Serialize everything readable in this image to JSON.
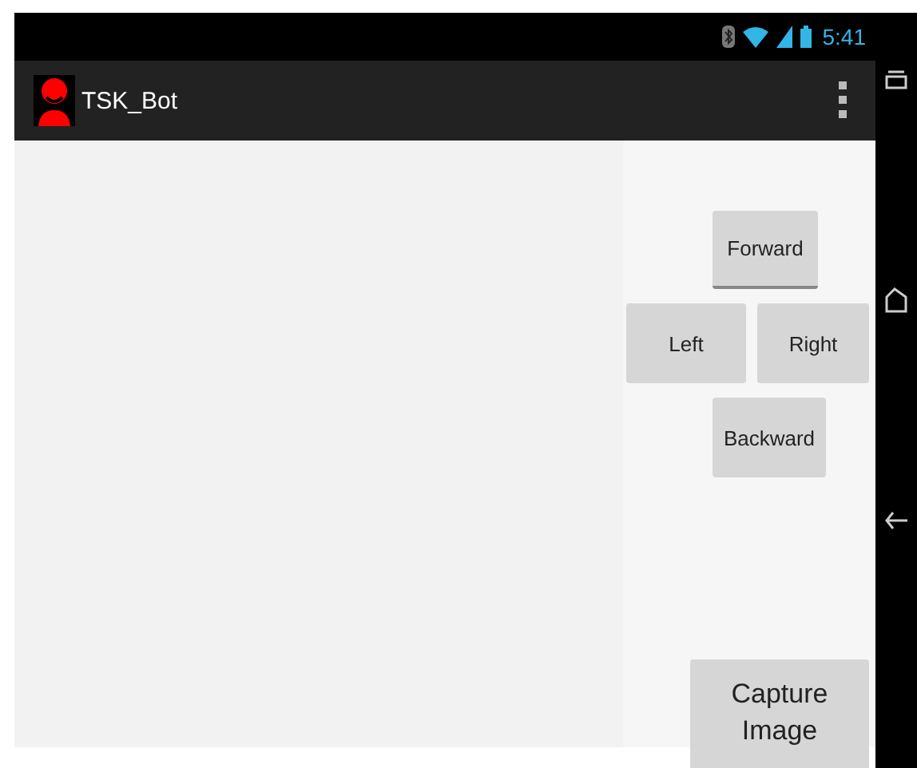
{
  "status_bar": {
    "time": "5:41"
  },
  "action_bar": {
    "title": "TSK_Bot"
  },
  "controls": [
    {
      "label": "Forward"
    },
    {
      "label": "Left"
    },
    {
      "label": "Right"
    },
    {
      "label": "Backward"
    }
  ],
  "capture_button": {
    "label": "Capture Image"
  }
}
